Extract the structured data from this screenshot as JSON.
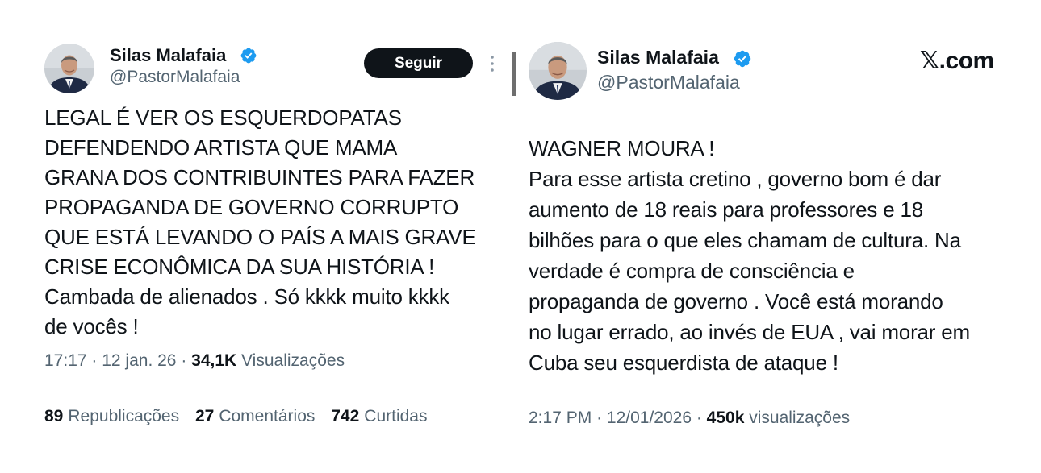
{
  "left_tweet": {
    "author": {
      "name": "Silas Malafaia",
      "handle": "@PastorMalafaia",
      "verified": true,
      "avatar_icon": "profile-photo"
    },
    "follow_label": "Seguir",
    "more_icon": "more-vertical-icon",
    "text": "LEGAL É VER OS ESQUERDOPATAS\nDEFENDENDO ARTISTA QUE MAMA\nGRANA DOS CONTRIBUINTES PARA FAZER\nPROPAGANDA DE GOVERNO CORRUPTO\nQUE ESTÁ LEVANDO O PAÍS A MAIS GRAVE\nCRISE ECONÔMICA DA SUA HISTÓRIA !\nCambada de alienados . Só kkkk muito kkkk\nde vocês !",
    "time": "17:17",
    "date": "12 jan. 26",
    "views_count": "34,1K",
    "views_label": "Visualizações",
    "stats": [
      {
        "count": "89",
        "label": "Republicações"
      },
      {
        "count": "27",
        "label": "Comentários"
      },
      {
        "count": "742",
        "label": "Curtidas"
      }
    ]
  },
  "right_tweet": {
    "author": {
      "name": "Silas Malafaia",
      "handle": "@PastorMalafaia",
      "verified": true,
      "avatar_icon": "profile-photo"
    },
    "brand_mark": "𝕏",
    "brand_suffix": ".com",
    "text": "WAGNER MOURA !\nPara esse artista cretino , governo bom é dar\naumento de 18 reais para professores e 18\nbilhões para o que eles chamam de cultura. Na\nverdade é compra de consciência e\npropaganda de governo . Você está morando\nno lugar errado, ao invés de EUA , vai morar em\nCuba seu esquerdista de ataque !",
    "time": "2:17 PM",
    "date": "12/01/2026",
    "views_count": "450k",
    "views_label": "visualizações"
  },
  "colors": {
    "text_primary": "#0f1419",
    "text_secondary": "#536471",
    "verified_blue": "#1d9bf0",
    "follow_bg": "#0f1419"
  }
}
